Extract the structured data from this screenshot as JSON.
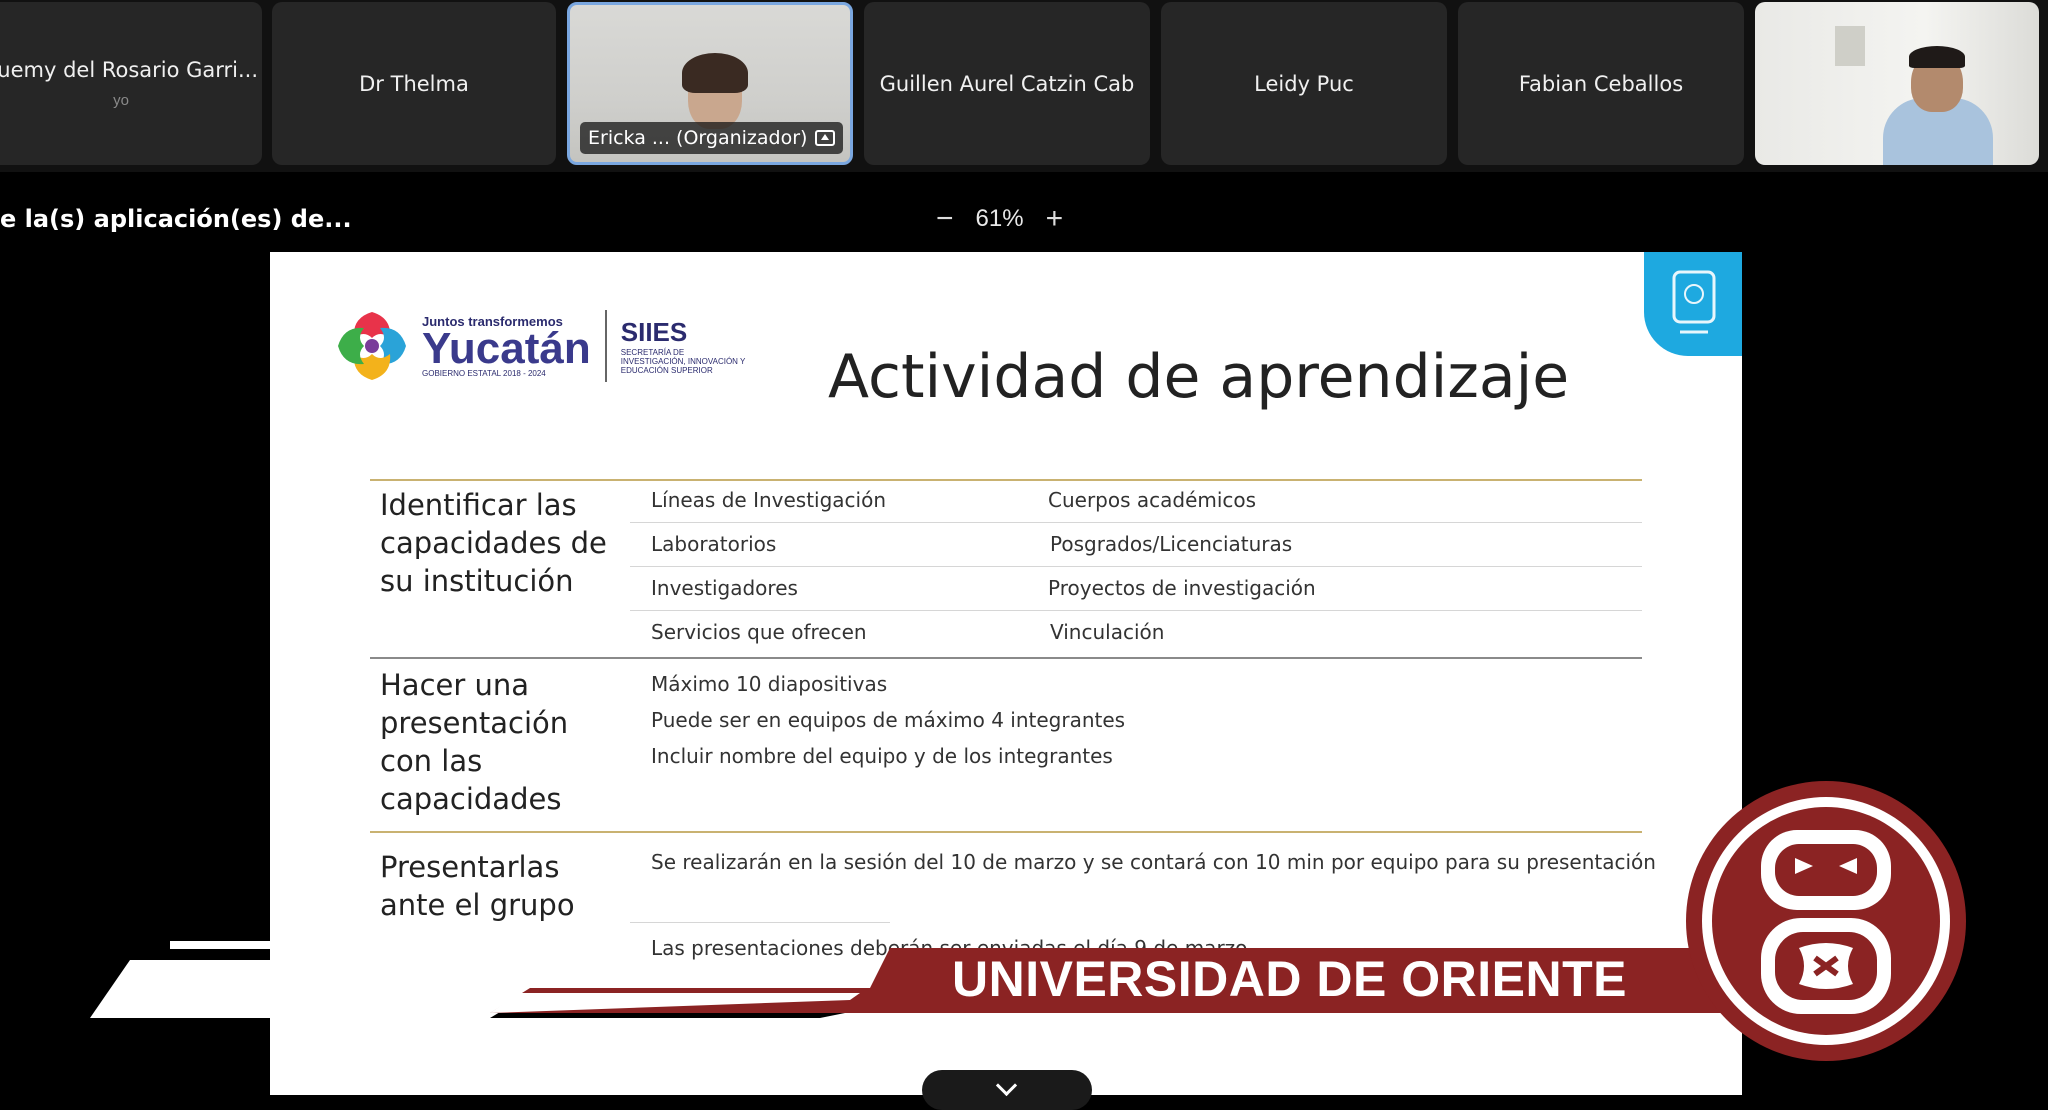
{
  "participants": [
    {
      "name": "Suemy del Rosario Garri...",
      "sub": "yo"
    },
    {
      "name": "Dr Thelma"
    },
    {
      "name": "Ericka ... (Organizador)",
      "video": true
    },
    {
      "name": "Guillen Aurel Catzin Cab"
    },
    {
      "name": "Leidy Puc"
    },
    {
      "name": "Fabian Ceballos"
    },
    {
      "video": true
    }
  ],
  "share": {
    "title": "e la(s) aplicación(es) de...",
    "zoom_minus": "−",
    "zoom_value": "61%",
    "zoom_plus": "+"
  },
  "slide": {
    "logo": {
      "tagline": "Juntos transformemos",
      "name": "Yucatán",
      "gov": "GOBIERNO ESTATAL 2018 - 2024",
      "siies": "SIIES",
      "siies_desc": "SECRETARÍA DE INVESTIGACIÓN, INNOVACIÓN Y EDUCACIÓN SUPERIOR"
    },
    "title": "Actividad de aprendizaje",
    "rows": [
      {
        "head": "Identificar las capacidades de su institución",
        "items": [
          [
            "Líneas de Investigación",
            "Cuerpos académicos"
          ],
          [
            "Laboratorios",
            "Posgrados/Licenciaturas"
          ],
          [
            "Investigadores",
            "Proyectos de investigación"
          ],
          [
            "Servicios que ofrecen",
            "Vinculación"
          ]
        ]
      },
      {
        "head": "Hacer una presentación con las capacidades",
        "items": [
          "Máximo 10 diapositivas",
          "Puede ser en equipos de máximo 4 integrantes",
          "Incluir nombre del equipo y de los integrantes"
        ]
      },
      {
        "head": "Presentarlas ante el grupo",
        "items": [
          "Se realizarán en la sesión del 10 de marzo y se contará con 10 min por equipo para su presentación",
          "Las presentaciones deberán ser enviadas el día 9 de marzo"
        ]
      }
    ]
  },
  "lower_third": {
    "text": "UNIVERSIDAD DE ORIENTE"
  },
  "colors": {
    "brand_red": "#8b2323",
    "slide_accent": "#1ea9e0",
    "gold_rule": "#c9b271"
  }
}
